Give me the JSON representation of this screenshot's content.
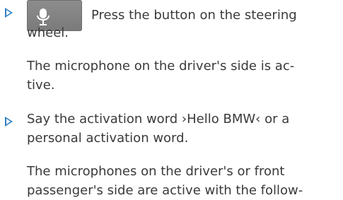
{
  "steps": [
    {
      "first_line": "Press the button on the steering",
      "continuation": "wheel.",
      "note": {
        "line1": "The microphone on the driver's side is ac-",
        "line2": "tive."
      }
    },
    {
      "line1": "Say the activation word ›Hello BMW‹ or a",
      "line2": "personal activation word.",
      "note": {
        "line1": "The microphones on the driver's or front",
        "line2": "passenger's side are active with the follow-"
      }
    }
  ],
  "icons": {
    "bullet": "triangle-bullet-icon",
    "button": "microphone-button-icon"
  },
  "colors": {
    "accent": "#2f7fc1",
    "text": "#3a3a3a",
    "button": "#808080"
  }
}
